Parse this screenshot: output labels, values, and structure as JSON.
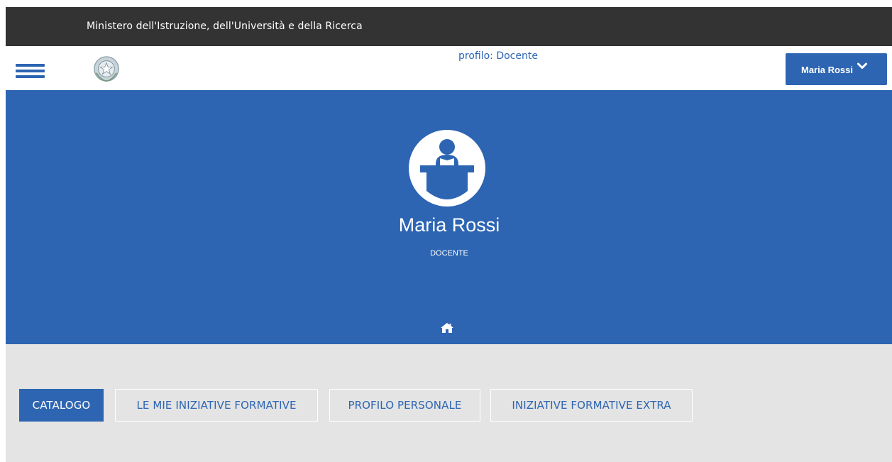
{
  "topbar": {
    "title": "Ministero dell'Istruzione, dell'Università e della Ricerca"
  },
  "header": {
    "profile_label": "profilo: Docente",
    "user_button": "Maria Rossi"
  },
  "hero": {
    "name": "Maria Rossi",
    "role": "DOCENTE"
  },
  "tabs": [
    {
      "label": "CATALOGO",
      "active": true
    },
    {
      "label": "LE MIE INIZIATIVE FORMATIVE",
      "active": false
    },
    {
      "label": "PROFILO PERSONALE",
      "active": false
    },
    {
      "label": "INIZIATIVE FORMATIVE EXTRA",
      "active": false
    }
  ],
  "colors": {
    "brand_blue": "#2d65b2",
    "topbar_dark": "#333333",
    "content_bg": "#e4e4e4"
  },
  "icons": [
    "hamburger-menu-icon",
    "italian-republic-emblem-icon",
    "chevron-down-icon",
    "teacher-avatar-icon",
    "home-icon"
  ]
}
